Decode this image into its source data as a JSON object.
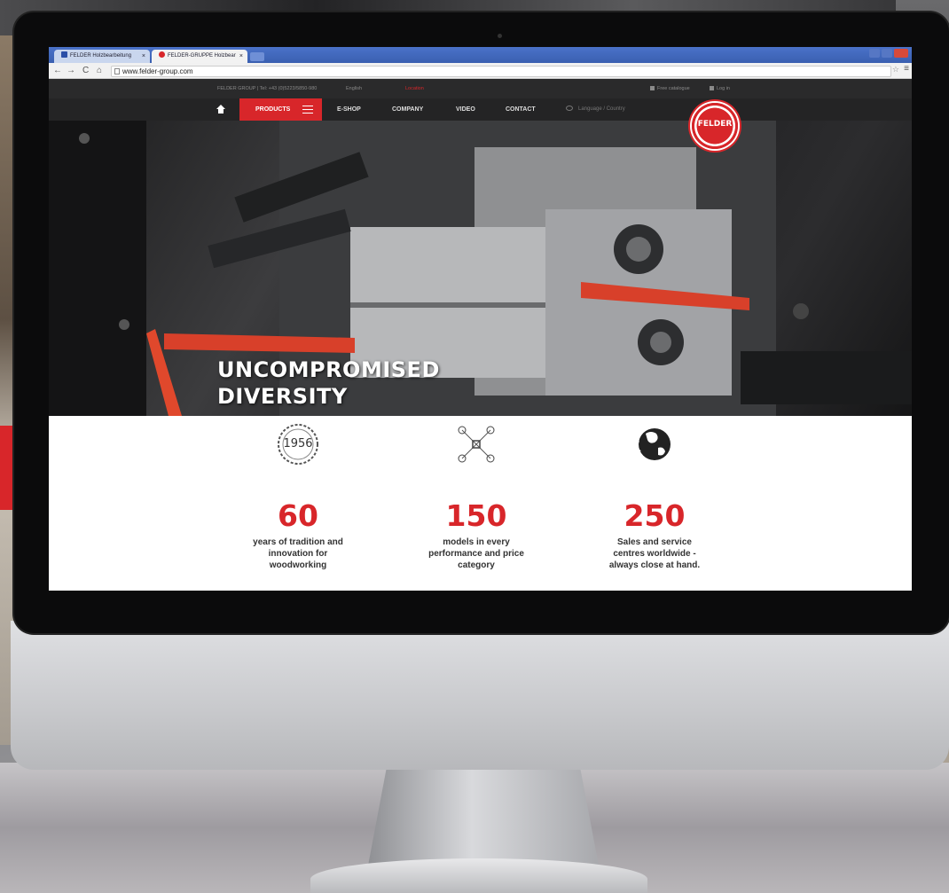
{
  "browser": {
    "tabs": [
      {
        "label": "FELDER Holzbearbeitung",
        "active": false
      },
      {
        "label": "FELDER-GRUPPE Holzbear",
        "active": true
      }
    ],
    "tab_close": "×",
    "url": "www.felder-group.com",
    "icons": [
      "back-arrow-icon",
      "forward-arrow-icon",
      "reload-icon",
      "home-icon",
      "star-icon",
      "menu-icon"
    ]
  },
  "topbar": {
    "phone": "FELDER GROUP | Tel: +43 (0)5223/5850-980",
    "language": "English",
    "location": "Location",
    "catalogue": "Free catalogue",
    "login": "Log in"
  },
  "nav": {
    "products": "PRODUCTS",
    "eshop": "E-SHOP",
    "company": "COMPANY",
    "video": "VIDEO",
    "contact": "CONTACT",
    "language": "Language / Country"
  },
  "logo": {
    "text": "FELDER"
  },
  "hero": {
    "line1": "UNCOMPROMISED",
    "line2": "DIVERSITY"
  },
  "stats": [
    {
      "badge": "1956",
      "number": "60",
      "description": "years of tradition and\ninnovation for\nwoodworking",
      "icon": "gear-badge-icon"
    },
    {
      "number": "150",
      "description": "models in every\nperformance and price\ncategory",
      "icon": "network-icon"
    },
    {
      "number": "250",
      "description": "Sales and service\ncentres worldwide -\nalways close at hand.",
      "icon": "globe-icon"
    }
  ],
  "colors": {
    "accent": "#d8262a",
    "nav_bg": "#242425",
    "topbar_bg": "#2a2a2b"
  }
}
